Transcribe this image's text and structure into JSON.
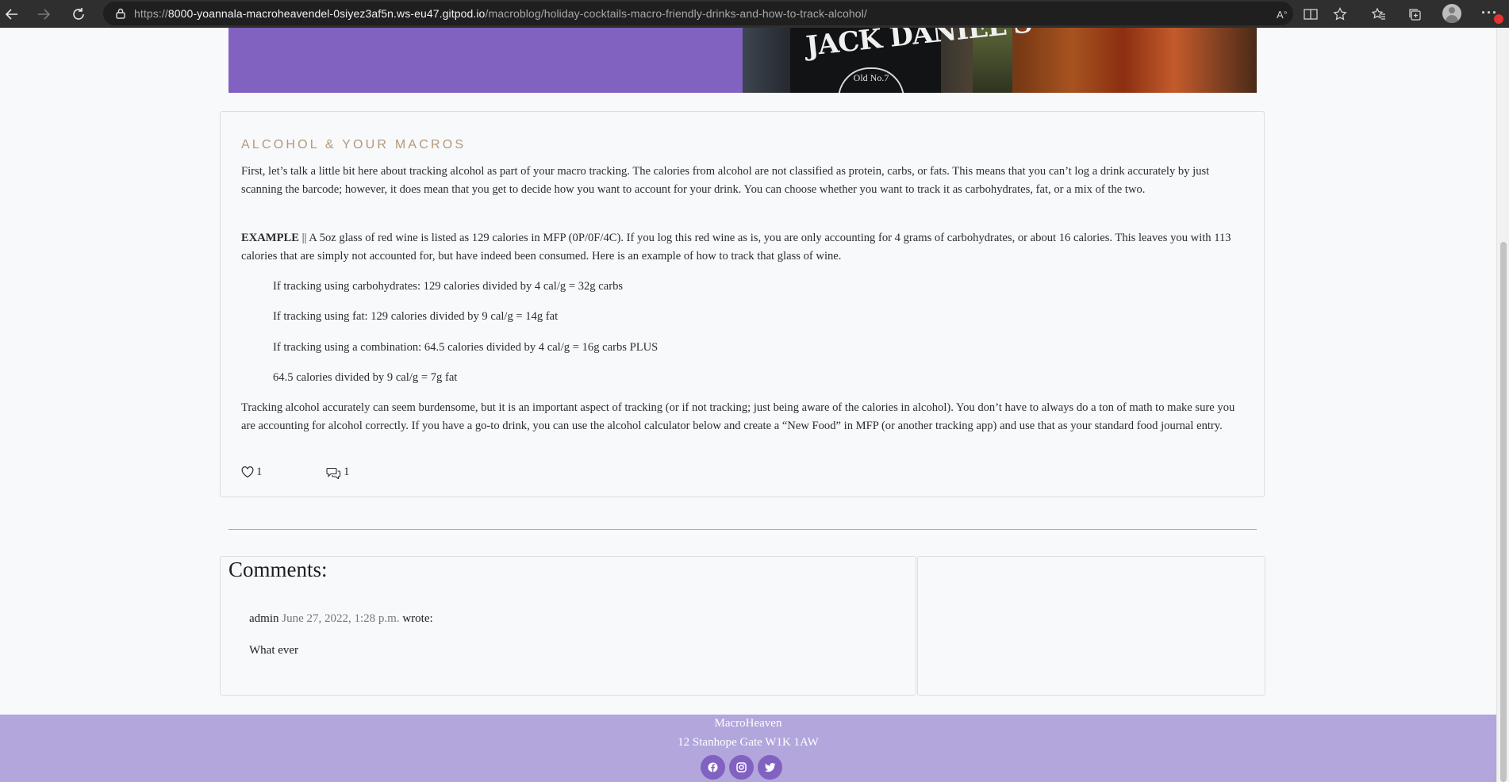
{
  "browser": {
    "url_protocol": "https://",
    "url_host": "8000-yoannala-macroheavendel-0siyez3af5n.ws-eu47.gitpod.io",
    "url_path": "/macroblog/holiday-cocktails-macro-friendly-drinks-and-how-to-track-alcohol/",
    "icons": [
      "back-icon",
      "forward-icon",
      "refresh-icon",
      "lock-icon",
      "read-aloud-icon",
      "immersive-reader-icon",
      "add-favorite-icon",
      "favorites-icon",
      "collections-icon",
      "profile-icon",
      "more-icon"
    ]
  },
  "hero": {
    "image_text": "JACK DANIEL'S",
    "image_badge": "Old No.7"
  },
  "article": {
    "section_title": "ALCOHOL & YOUR MACROS",
    "paragraph1": "First, let’s talk a little bit here about tracking alcohol as part of your macro tracking. The calories from alcohol are not classified as protein, carbs, or fats. This means that you can’t log a drink accurately by just scanning the barcode; however, it does mean that you get to decide how you want to account for your drink. You can choose whether you want to track it as carbohydrates, fat, or a mix of the two.",
    "example_label": "EXAMPLE",
    "example_text": " ||  A 5oz glass of red wine is listed as 129 calories in MFP (0P/0F/4C). If you log this red wine as is, you are only accounting for 4 grams of carbohydrates, or about 16 calories. This leaves you with 113 calories that are simply not accounted for, but have indeed been consumed. Here is an example of how to track that glass of wine.",
    "line1": "If tracking using carbohydrates: 129 calories divided by 4 cal/g = 32g carbs",
    "line2": "If tracking using fat: 129 calories divided by 9 cal/g = 14g fat",
    "line3": "If tracking using a combination: 64.5 calories divided by 4 cal/g = 16g carbs   PLUS",
    "line4": "64.5 calories divided by 9 cal/g = 7g fat",
    "paragraph3": "Tracking alcohol accurately can seem burdensome, but it is an important aspect of tracking (or if not tracking; just being aware of the calories in alcohol). You don’t have to always do a ton of math to make sure you are accounting for alcohol correctly. If you have a go-to drink, you can use the alcohol calculator below and create a “New Food” in MFP (or another tracking app) and use that as your standard food journal entry.",
    "likes": "1",
    "comments_count": "1"
  },
  "comments": {
    "heading": "Comments:",
    "items": [
      {
        "author": "admin",
        "date": "June 27, 2022, 1:28 p.m.",
        "verb": "wrote:",
        "body": "What ever"
      }
    ]
  },
  "footer": {
    "brand": "MacroHeaven",
    "address": "12 Stanhope Gate W1K 1AW",
    "social": [
      "facebook-icon",
      "instagram-icon",
      "twitter-icon"
    ]
  },
  "colors": {
    "accent": "#8162c0",
    "footer_bg": "#b2a6dc",
    "section_title": "#b2997a",
    "page_bg": "#f8f9fb"
  }
}
